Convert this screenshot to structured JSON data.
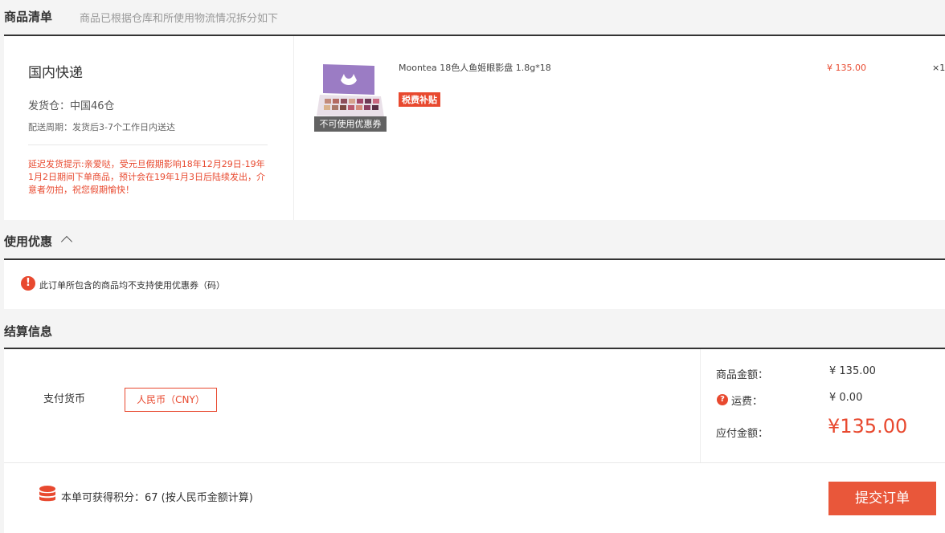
{
  "order": {
    "title": "商品清单",
    "hint": "商品已根据仓库和所使用物流情况拆分如下",
    "shipping": {
      "method": "国内快递",
      "warehouse": "发货仓：中国46仓",
      "period": "配送周期：发货后3-7个工作日内送达",
      "delay_notice": "延迟发货提示:亲爱哒，受元旦假期影响18年12月29日-19年1月2日期间下单商品，预计会在19年1月3日后陆续发出，介意者勿拍，祝您假期愉快！"
    },
    "product": {
      "name": "Moontea 18色人鱼姬眼影盘 1.8g*18",
      "tag": "税费补贴",
      "badge": "不可使用优惠券",
      "price": "¥ 135.00",
      "qty": "×1"
    }
  },
  "coupon": {
    "title": "使用优惠",
    "notice": "此订单所包含的商品均不支持使用优惠券（码）"
  },
  "settlement": {
    "title": "结算信息",
    "pay_currency_label": "支付货币",
    "currency": "人民币（CNY）",
    "goods_amount_label": "商品金额：",
    "goods_amount": "¥ 135.00",
    "shipping_label": "运费：",
    "shipping_fee": "¥ 0.00",
    "payable_label": "应付金额：",
    "payable": "¥135.00"
  },
  "footer": {
    "points_text": "本单可获得积分：67  (按人民币金额计算)",
    "submit_label": "提交订单"
  },
  "colors": {
    "accent": "#e8492f",
    "button": "#e9573a"
  }
}
